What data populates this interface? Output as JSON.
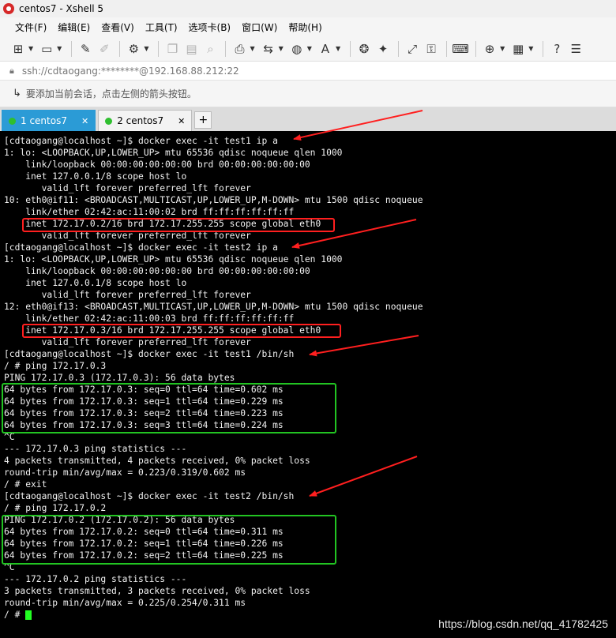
{
  "window": {
    "title": "centos7 - Xshell 5"
  },
  "menu": [
    "文件(F)",
    "编辑(E)",
    "查看(V)",
    "工具(T)",
    "选项卡(B)",
    "窗口(W)",
    "帮助(H)"
  ],
  "address": {
    "text": "ssh://cdtaogang:********@192.168.88.212:22"
  },
  "hint": {
    "text": "要添加当前会话，点击左侧的箭头按钮。"
  },
  "tabs": [
    {
      "label": "1 centos7",
      "close": "✕",
      "active": true
    },
    {
      "label": "2 centos7",
      "close": "✕",
      "active": false
    }
  ],
  "tab_add": "+",
  "terminal": {
    "lines": [
      "[cdtaogang@localhost ~]$ docker exec -it test1 ip a",
      "1: lo: <LOOPBACK,UP,LOWER_UP> mtu 65536 qdisc noqueue qlen 1000",
      "    link/loopback 00:00:00:00:00:00 brd 00:00:00:00:00:00",
      "    inet 127.0.0.1/8 scope host lo",
      "       valid_lft forever preferred_lft forever",
      "10: eth0@if11: <BROADCAST,MULTICAST,UP,LOWER_UP,M-DOWN> mtu 1500 qdisc noqueue",
      "    link/ether 02:42:ac:11:00:02 brd ff:ff:ff:ff:ff:ff",
      "    inet 172.17.0.2/16 brd 172.17.255.255 scope global eth0",
      "       valid_lft forever preferred_lft forever",
      "[cdtaogang@localhost ~]$ docker exec -it test2 ip a",
      "1: lo: <LOOPBACK,UP,LOWER_UP> mtu 65536 qdisc noqueue qlen 1000",
      "    link/loopback 00:00:00:00:00:00 brd 00:00:00:00:00:00",
      "    inet 127.0.0.1/8 scope host lo",
      "       valid_lft forever preferred_lft forever",
      "12: eth0@if13: <BROADCAST,MULTICAST,UP,LOWER_UP,M-DOWN> mtu 1500 qdisc noqueue",
      "    link/ether 02:42:ac:11:00:03 brd ff:ff:ff:ff:ff:ff",
      "    inet 172.17.0.3/16 brd 172.17.255.255 scope global eth0",
      "       valid_lft forever preferred_lft forever",
      "[cdtaogang@localhost ~]$ docker exec -it test1 /bin/sh",
      "/ # ping 172.17.0.3",
      "PING 172.17.0.3 (172.17.0.3): 56 data bytes",
      "64 bytes from 172.17.0.3: seq=0 ttl=64 time=0.602 ms",
      "64 bytes from 172.17.0.3: seq=1 ttl=64 time=0.229 ms",
      "64 bytes from 172.17.0.3: seq=2 ttl=64 time=0.223 ms",
      "64 bytes from 172.17.0.3: seq=3 ttl=64 time=0.224 ms",
      "^C",
      "--- 172.17.0.3 ping statistics ---",
      "4 packets transmitted, 4 packets received, 0% packet loss",
      "round-trip min/avg/max = 0.223/0.319/0.602 ms",
      "/ # exit",
      "[cdtaogang@localhost ~]$ docker exec -it test2 /bin/sh",
      "/ # ping 172.17.0.2",
      "PING 172.17.0.2 (172.17.0.2): 56 data bytes",
      "64 bytes from 172.17.0.2: seq=0 ttl=64 time=0.311 ms",
      "64 bytes from 172.17.0.2: seq=1 ttl=64 time=0.226 ms",
      "64 bytes from 172.17.0.2: seq=2 ttl=64 time=0.225 ms",
      "^C",
      "--- 172.17.0.2 ping statistics ---",
      "3 packets transmitted, 3 packets received, 0% packet loss",
      "round-trip min/avg/max = 0.225/0.254/0.311 ms",
      "/ # "
    ]
  },
  "watermark": "https://blog.csdn.net/qq_41782425",
  "colors": {
    "terminal_bg": "#000000",
    "terminal_fg": "#f2f2f2",
    "highlight_red": "#ff1f1f",
    "highlight_green": "#22c422",
    "cursor": "#22ff22",
    "active_tab": "#2b9bd6"
  }
}
